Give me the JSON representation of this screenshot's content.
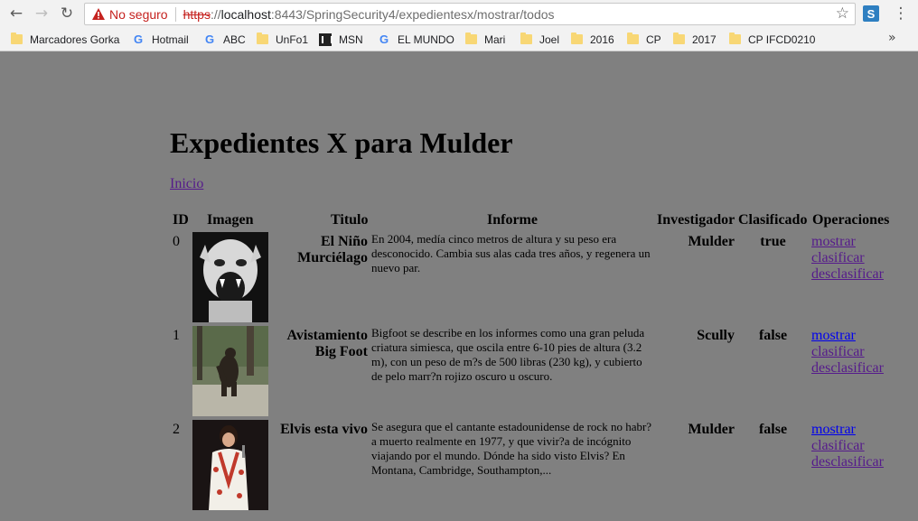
{
  "browser": {
    "security_label": "No seguro",
    "url_protocol": "https",
    "url_sep": "://",
    "url_host": "localhost",
    "url_rest": ":8443/SpringSecurity4/expedientesx/mostrar/todos",
    "ext_letter": "S",
    "bookmarks": [
      {
        "label": "Marcadores Gorka",
        "icon": "folder-icon"
      },
      {
        "label": "Hotmail",
        "icon": "google-icon"
      },
      {
        "label": "ABC",
        "icon": "google-icon"
      },
      {
        "label": "UnFo1",
        "icon": "folder-icon"
      },
      {
        "label": "MSN",
        "icon": "msn-icon"
      },
      {
        "label": "EL MUNDO",
        "icon": "google-icon"
      },
      {
        "label": "Mari",
        "icon": "folder-icon"
      },
      {
        "label": "Joel",
        "icon": "folder-icon"
      },
      {
        "label": "2016",
        "icon": "folder-icon"
      },
      {
        "label": "CP",
        "icon": "folder-icon"
      },
      {
        "label": "2017",
        "icon": "folder-icon"
      },
      {
        "label": "CP IFCD0210",
        "icon": "folder-icon"
      }
    ],
    "more_bookmarks": "»"
  },
  "page": {
    "title": "Expedientes X para Mulder",
    "home_link": "Inicio"
  },
  "table": {
    "headers": [
      "ID",
      "Imagen",
      "Titulo",
      "Informe",
      "Investigador",
      "Clasificado",
      "Operaciones"
    ],
    "rows": [
      {
        "id": "0",
        "image": "bat-boy-image",
        "title": "El Niño Murciélago",
        "report": "En 2004, medía cinco metros de altura y su peso era desconocido. Cambia sus alas cada tres años, y regenera un nuevo par.",
        "investigator": "Mulder",
        "classified": "true",
        "ops": [
          "mostrar",
          "clasificar",
          "desclasificar"
        ]
      },
      {
        "id": "1",
        "image": "bigfoot-image",
        "title": "Avistamiento Big Foot",
        "report": "Bigfoot se describe en los informes como una gran peluda criatura simiesca, que oscila entre 6-10 pies de altura (3.2 m), con un peso de m?s de 500 libras (230 kg), y cubierto de pelo marr?n rojizo oscuro u oscuro.",
        "investigator": "Scully",
        "classified": "false",
        "ops": [
          "mostrar",
          "clasificar",
          "desclasificar"
        ]
      },
      {
        "id": "2",
        "image": "elvis-image",
        "title": "Elvis esta vivo",
        "report": "Se asegura que el cantante estadounidense de rock no habr? a muerto realmente en 1977, y que vivir?a de incógnito viajando por el mundo. Dónde ha sido visto Elvis? En Montana, Cambridge, Southampton,...",
        "investigator": "Mulder",
        "classified": "false",
        "ops": [
          "mostrar",
          "clasificar",
          "desclasificar"
        ]
      }
    ]
  }
}
